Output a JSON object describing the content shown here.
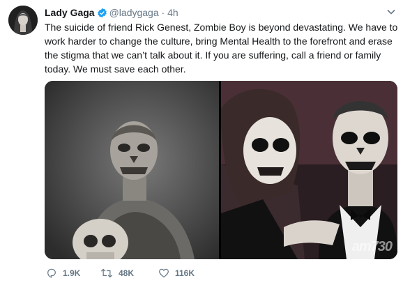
{
  "tweet": {
    "display_name": "Lady Gaga",
    "handle": "@ladygaga",
    "separator": "·",
    "time": "4h",
    "text": "The suicide of friend Rick Genest, Zombie Boy is beyond devastating. We have to work harder to change the culture, bring Mental Health to the forefront and erase the stigma that we can’t talk about it. If you are suffering, call a friend or family today. We must save each other."
  },
  "actions": {
    "replies": "1.9K",
    "retweets": "48K",
    "likes": "116K"
  },
  "watermark": "am730",
  "colors": {
    "verified": "#1da1f2",
    "secondary_text": "#657786",
    "primary_text": "#14171a"
  },
  "icons": [
    "verified-badge-icon",
    "chevron-down-icon",
    "reply-icon",
    "retweet-icon",
    "like-icon"
  ]
}
